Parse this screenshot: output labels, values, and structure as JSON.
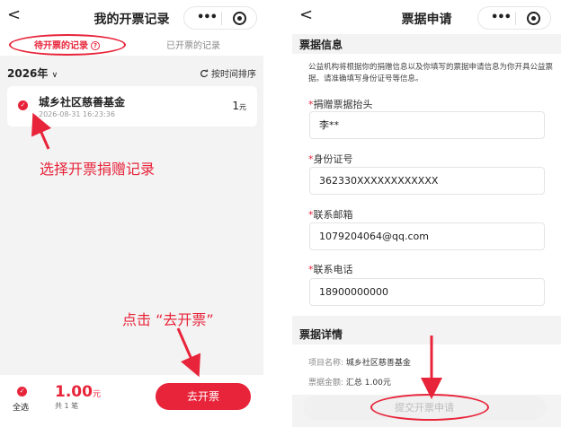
{
  "left": {
    "nav_back": "<",
    "title": "我的开票记录",
    "tabs": {
      "pending": "待开票的记录",
      "help": "?",
      "done": "已开票的记录"
    },
    "year": "2026年",
    "year_caret": "∨",
    "sort": "按时间排序",
    "record": {
      "check": "✓",
      "name": "城乡社区慈善基金",
      "date": "2026-08-31 16:23:36",
      "amount": "1",
      "unit": "元"
    },
    "annotation_select": "选择开票捐赠记录",
    "annotation_click": "点击 “去开票”",
    "bottom": {
      "check": "✓",
      "select_all": "全选",
      "total": "1.00",
      "unit": "元",
      "count": "共 1 笔",
      "button": "去开票"
    }
  },
  "right": {
    "nav_back": "<",
    "title": "票据申请",
    "info_heading": "票据信息",
    "intro": "公益机构将根据你的捐赠信息以及你填写的票据申请信息为你开具公益票据。请准确填写身份证号等信息。",
    "fields": [
      {
        "required": "*",
        "label": "捐赠票据抬头",
        "value": "李**"
      },
      {
        "required": "*",
        "label": "身份证号",
        "value": "362330XXXXXXXXXXXX"
      },
      {
        "required": "*",
        "label": "联系邮箱",
        "value": "1079204064@qq.com"
      },
      {
        "required": "*",
        "label": "联系电话",
        "value": "18900000000"
      }
    ],
    "detail_heading": "票据详情",
    "details": [
      {
        "key": "项目名称:",
        "value": "城乡社区慈善基金"
      },
      {
        "key": "票据金额:",
        "value": "汇总 1.00元"
      }
    ],
    "submit": "提交开票申请"
  },
  "capsule": {
    "dots": "•••"
  },
  "colors": {
    "accent": "#e8243a",
    "background": "#f3f3f3"
  }
}
